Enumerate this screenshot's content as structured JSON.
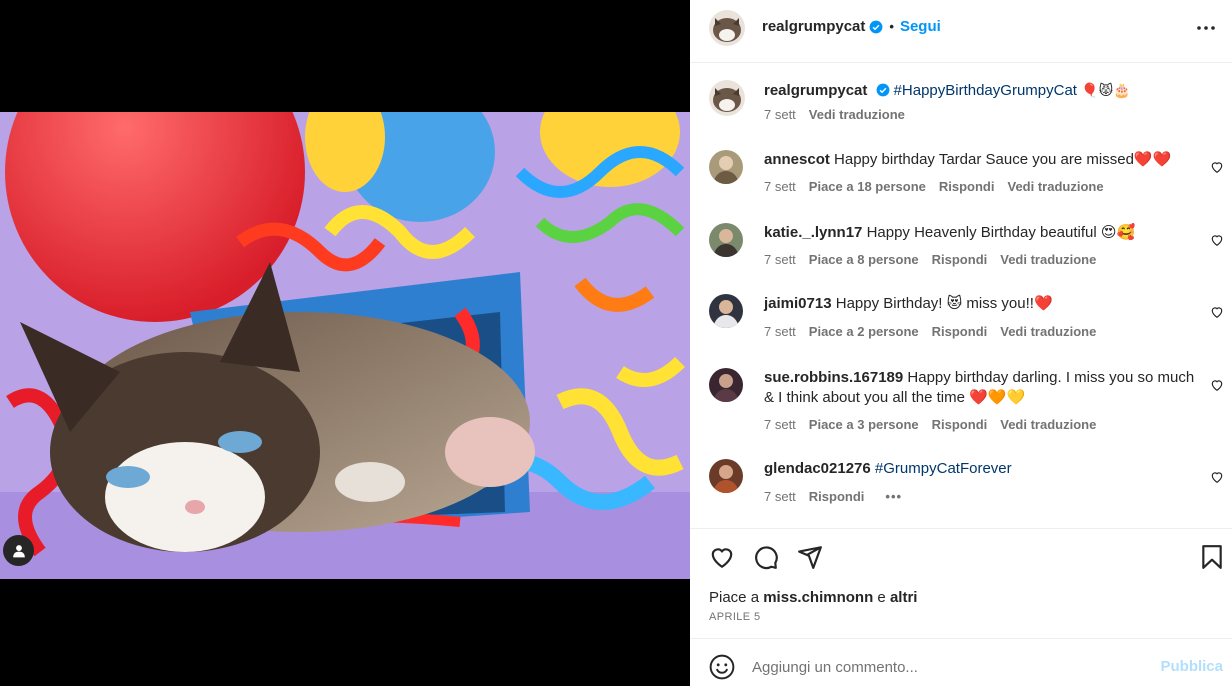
{
  "post": {
    "username": "realgrumpycat",
    "follow_label": "Segui",
    "separator": "•"
  },
  "caption": {
    "username": "realgrumpycat",
    "hashtag": "#HappyBirthdayGrumpyCat",
    "emoji": "🎈😾🎂",
    "time": "7 sett",
    "translate": "Vedi traduzione"
  },
  "comments": [
    {
      "username": "annescot",
      "text": "Happy birthday Tardar Sauce you are missed❤️❤️",
      "time": "7 sett",
      "likes": "Piace a 18 persone",
      "reply": "Rispondi",
      "translate": "Vedi traduzione"
    },
    {
      "username": "katie._.lynn17",
      "text": "Happy Heavenly Birthday beautiful 😍🥰",
      "time": "7 sett",
      "likes": "Piace a 8 persone",
      "reply": "Rispondi",
      "translate": "Vedi traduzione"
    },
    {
      "username": "jaimi0713",
      "text": "Happy Birthday! 😻 miss you!!❤️",
      "time": "7 sett",
      "likes": "Piace a 2 persone",
      "reply": "Rispondi",
      "translate": "Vedi traduzione"
    },
    {
      "username": "sue.robbins.167189",
      "text": "Happy birthday darling. I miss you so much & I think about you all the time ❤️🧡💛",
      "time": "7 sett",
      "likes": "Piace a 3 persone",
      "reply": "Rispondi",
      "translate": "Vedi traduzione"
    },
    {
      "username": "glendac021276",
      "hashtag": "#GrumpyCatForever",
      "time": "7 sett",
      "reply": "Rispondi",
      "more": "•••"
    }
  ],
  "likes_line": {
    "prefix": "Piace a",
    "user": "miss.chimnonn",
    "conj": "e",
    "others": "altri"
  },
  "date": "APRILE 5",
  "add_comment": {
    "placeholder": "Aggiungi un commento...",
    "publish": "Pubblica"
  },
  "colors": {
    "link": "#0095f6",
    "hashtag": "#00376b",
    "muted": "#737373",
    "verified": "#0095f6",
    "photo_bg": "#b9a2e6"
  },
  "icons": [
    "more-icon",
    "verified-icon",
    "heart-icon",
    "comment-icon",
    "share-icon",
    "bookmark-icon",
    "smile-icon",
    "user-tag-icon"
  ]
}
